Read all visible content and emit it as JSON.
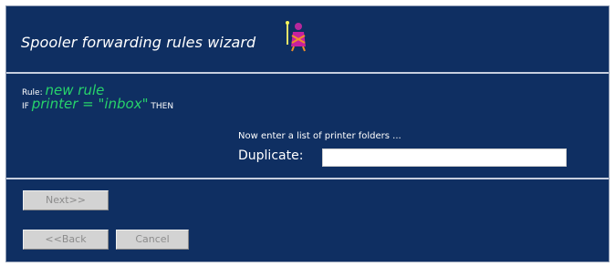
{
  "wizard": {
    "title": "Spooler forwarding rules wizard",
    "icon": "wizard-figure-icon"
  },
  "rule": {
    "rule_label": "Rule:",
    "rule_name": "new rule",
    "if_label": "IF",
    "condition": "printer = \"inbox\"",
    "then_label": "THEN"
  },
  "form": {
    "prompt": "Now enter a list of printer folders ...",
    "duplicate_label": "Duplicate:",
    "duplicate_value": ""
  },
  "buttons": {
    "next_label": "Next>>",
    "back_label": "<<Back",
    "cancel_label": "Cancel"
  },
  "colors": {
    "background": "#0f2f62",
    "accent_green": "#27d36b",
    "divider": "#c6cede",
    "button_face": "#d3d3d3"
  }
}
